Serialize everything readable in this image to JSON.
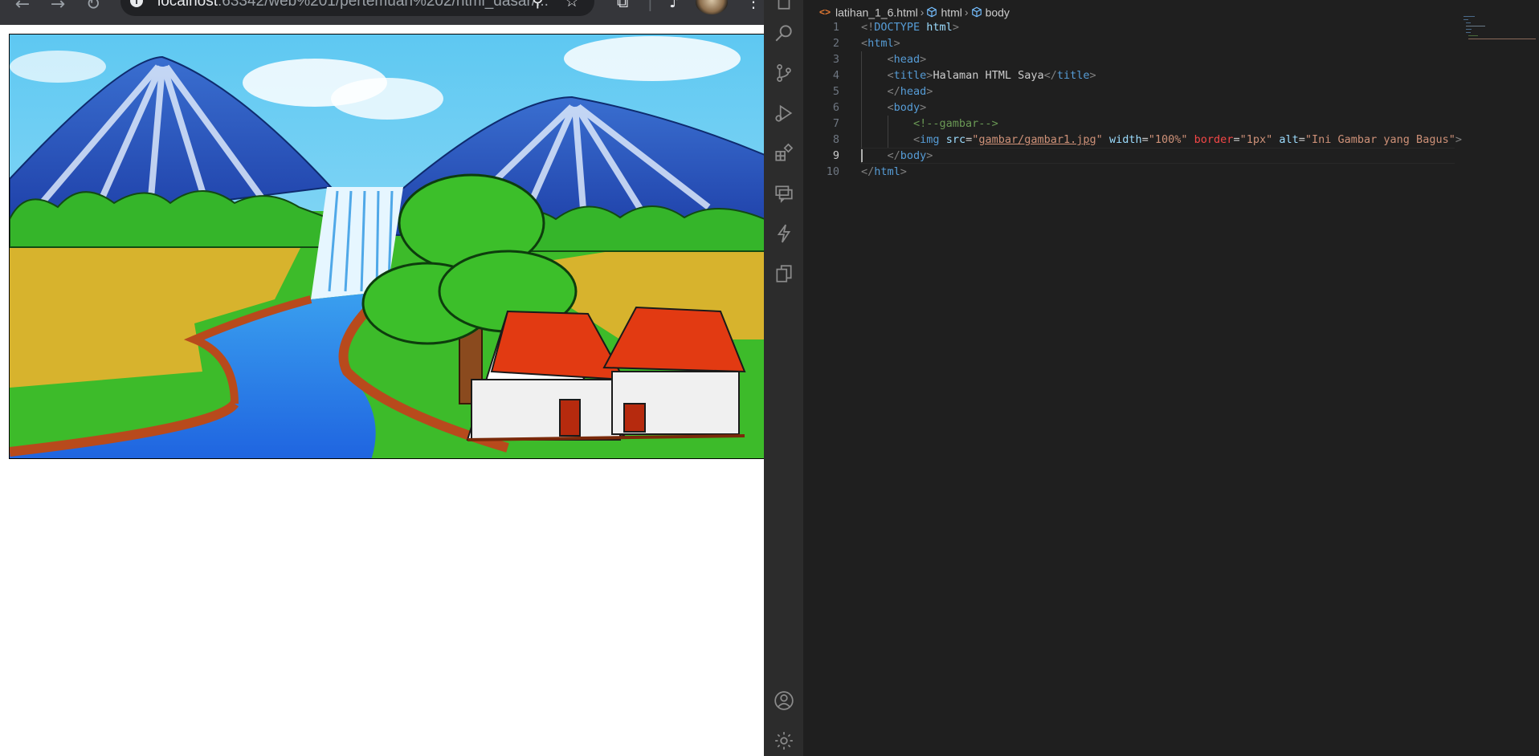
{
  "browser": {
    "url_host": "localhost",
    "url_rest": ":63342/web%201/pertemuan%202/html_dasar/...",
    "back_icon": "arrow-left-icon",
    "forward_icon": "arrow-right-icon",
    "reload_icon": "reload-icon",
    "zoom_icon": "zoom-icon",
    "bookmark_icon": "star-icon",
    "extensions_icon": "puzzle-icon",
    "media_icon": "music-icon",
    "menu_icon": "kebab-menu-icon"
  },
  "activity_bar": {
    "items": [
      "files-icon",
      "search-icon",
      "source-control-icon",
      "run-debug-icon",
      "extensions-icon",
      "remote-explorer-icon",
      "thunder-icon",
      "copy-icon"
    ],
    "bottom": [
      "account-icon",
      "settings-gear-icon"
    ]
  },
  "editor": {
    "breadcrumb": {
      "file": "latihan_1_6.html",
      "html": "html",
      "body": "body"
    },
    "cursor_line": 9,
    "lines": [
      {
        "n": "1",
        "tokens": [
          [
            "t-punc",
            "<!"
          ],
          [
            "t-doc",
            "DOCTYPE "
          ],
          [
            "t-attr",
            "html"
          ],
          [
            "t-punc",
            ">"
          ]
        ]
      },
      {
        "n": "2",
        "tokens": [
          [
            "t-punc",
            "<"
          ],
          [
            "t-tag",
            "html"
          ],
          [
            "t-punc",
            ">"
          ]
        ]
      },
      {
        "n": "3",
        "tokens": [
          [
            "t-text",
            "    "
          ],
          [
            "t-punc",
            "<"
          ],
          [
            "t-tag",
            "head"
          ],
          [
            "t-punc",
            ">"
          ]
        ]
      },
      {
        "n": "4",
        "tokens": [
          [
            "t-text",
            "    "
          ],
          [
            "t-punc",
            "<"
          ],
          [
            "t-tag",
            "title"
          ],
          [
            "t-punc",
            ">"
          ],
          [
            "t-text",
            "Halaman HTML Saya"
          ],
          [
            "t-punc",
            "</"
          ],
          [
            "t-tag",
            "title"
          ],
          [
            "t-punc",
            ">"
          ]
        ]
      },
      {
        "n": "5",
        "tokens": [
          [
            "t-text",
            "    "
          ],
          [
            "t-punc",
            "</"
          ],
          [
            "t-tag",
            "head"
          ],
          [
            "t-punc",
            ">"
          ]
        ]
      },
      {
        "n": "6",
        "tokens": [
          [
            "t-text",
            "    "
          ],
          [
            "t-punc",
            "<"
          ],
          [
            "t-tag",
            "body"
          ],
          [
            "t-punc",
            ">"
          ]
        ]
      },
      {
        "n": "7",
        "tokens": [
          [
            "t-text",
            "        "
          ],
          [
            "t-com",
            "<!--gambar-->"
          ]
        ]
      },
      {
        "n": "8",
        "tokens": [
          [
            "t-text",
            "        "
          ],
          [
            "t-punc",
            "<"
          ],
          [
            "t-tag",
            "img "
          ],
          [
            "t-attr",
            "src"
          ],
          [
            "t-text",
            "="
          ],
          [
            "t-str",
            "\""
          ],
          [
            "t-str t-link",
            "gambar/gambar1.jpg"
          ],
          [
            "t-str",
            "\""
          ],
          [
            "t-text",
            " "
          ],
          [
            "t-attr",
            "width"
          ],
          [
            "t-text",
            "="
          ],
          [
            "t-str",
            "\"100%\""
          ],
          [
            "t-text",
            " "
          ],
          [
            "t-attr2",
            "border"
          ],
          [
            "t-text",
            "="
          ],
          [
            "t-str",
            "\"1px\""
          ],
          [
            "t-text",
            " "
          ],
          [
            "t-attr",
            "alt"
          ],
          [
            "t-text",
            "="
          ],
          [
            "t-str",
            "\"Ini Gambar yang Bagus\""
          ],
          [
            "t-punc",
            ">"
          ]
        ]
      },
      {
        "n": "9",
        "tokens": [
          [
            "t-text",
            "    "
          ],
          [
            "t-punc",
            "</"
          ],
          [
            "t-tag",
            "body"
          ],
          [
            "t-punc",
            ">"
          ]
        ]
      },
      {
        "n": "10",
        "tokens": [
          [
            "t-punc",
            "</"
          ],
          [
            "t-tag",
            "html"
          ],
          [
            "t-punc",
            ">"
          ]
        ]
      }
    ]
  },
  "colors": {
    "editor_bg": "#1f1f1f",
    "activity_bg": "#2c2c2c",
    "tag": "#569cd6",
    "attr": "#9cdcfe",
    "string": "#ce9178",
    "comment": "#6a9955"
  }
}
